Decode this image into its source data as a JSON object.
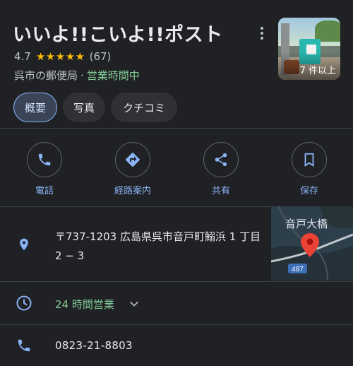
{
  "place": {
    "name": "いいよ!!こいよ!!ポスト",
    "rating": "4.7",
    "stars": "★★★★★",
    "review_count": "(67)",
    "category": "呉市の郵便局",
    "separator": "·",
    "open_status": "営業時間中",
    "photo_count": "7 件以上"
  },
  "tabs": [
    {
      "label": "概要",
      "active": true
    },
    {
      "label": "写真",
      "active": false
    },
    {
      "label": "クチコミ",
      "active": false
    }
  ],
  "actions": [
    {
      "label": "電話",
      "icon": "phone-icon"
    },
    {
      "label": "経路案内",
      "icon": "directions-icon"
    },
    {
      "label": "共有",
      "icon": "share-icon"
    },
    {
      "label": "保存",
      "icon": "bookmark-icon"
    }
  ],
  "details": {
    "address": "〒737-1203 広島県呉市音戸町鰯浜 1 丁目 2 − 3",
    "hours": "24 時間営業",
    "phone": "0823-21-8803"
  },
  "map": {
    "place_label": "音戸大橋",
    "route_number": "487"
  },
  "colors": {
    "background": "#202124",
    "accent": "#8ab4f8",
    "open_green": "#81c995",
    "star": "#fbbc04",
    "map_pin": "#ea4335"
  }
}
